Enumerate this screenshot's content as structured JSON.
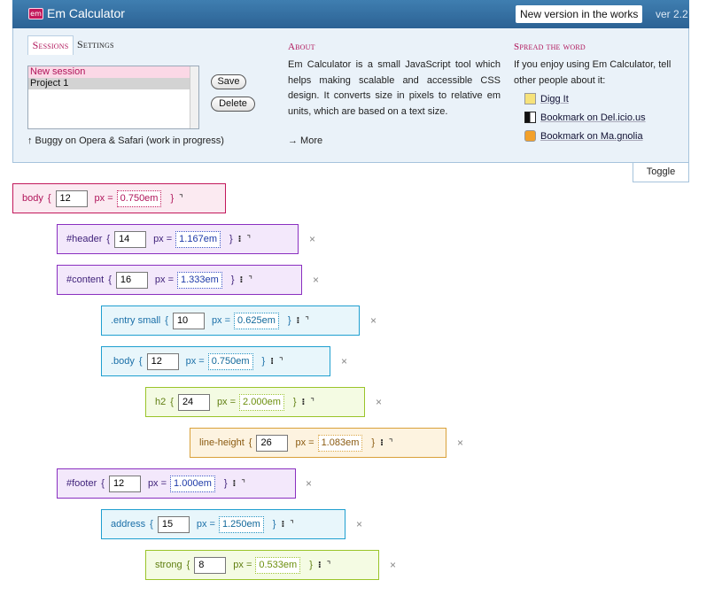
{
  "header": {
    "logo_text": "em",
    "title": "Em Calculator",
    "news_label": "New version in the works",
    "version": "ver 2.2"
  },
  "tabs": {
    "sessions": "Sessions",
    "settings": "Settings"
  },
  "sessions": {
    "items": [
      "New session",
      "Project 1"
    ],
    "save_label": "Save",
    "delete_label": "Delete",
    "note": "↑ Buggy on Opera & Safari (work in progress)"
  },
  "about": {
    "heading": "About",
    "text": "Em Calculator is a small JavaScript tool which helps making scalable and accessible CSS design. It converts size in pixels to relative em units, which are based on a text size.",
    "more_label": "→ More"
  },
  "spread": {
    "heading": "Spread the word",
    "text": "If you enjoy using Em Calculator, tell other people about it:",
    "links": [
      "Digg It",
      "Bookmark on Del.icio.us",
      "Bookmark on Ma.gnolia"
    ]
  },
  "toggle_label": "Toggle",
  "rules": [
    {
      "selector": "body",
      "px": "12",
      "em": "0.750em",
      "color": "pink"
    },
    {
      "selector": "#header",
      "px": "14",
      "em": "1.167em",
      "color": "purple"
    },
    {
      "selector": "#content",
      "px": "16",
      "em": "1.333em",
      "color": "purple"
    },
    {
      "selector": ".entry small",
      "px": "10",
      "em": "0.625em",
      "color": "teal"
    },
    {
      "selector": ".body",
      "px": "12",
      "em": "0.750em",
      "color": "teal"
    },
    {
      "selector": "h2",
      "px": "24",
      "em": "2.000em",
      "color": "green"
    },
    {
      "selector": "line-height",
      "px": "26",
      "em": "1.083em",
      "color": "orange"
    },
    {
      "selector": "#footer",
      "px": "12",
      "em": "1.000em",
      "color": "purple"
    },
    {
      "selector": "address",
      "px": "15",
      "em": "1.250em",
      "color": "teal"
    },
    {
      "selector": "strong",
      "px": "8",
      "em": "0.533em",
      "color": "green"
    }
  ],
  "rule_text": {
    "open_brace": "{",
    "px_eq": "px =",
    "close_brace": "}",
    "remove": "×"
  }
}
